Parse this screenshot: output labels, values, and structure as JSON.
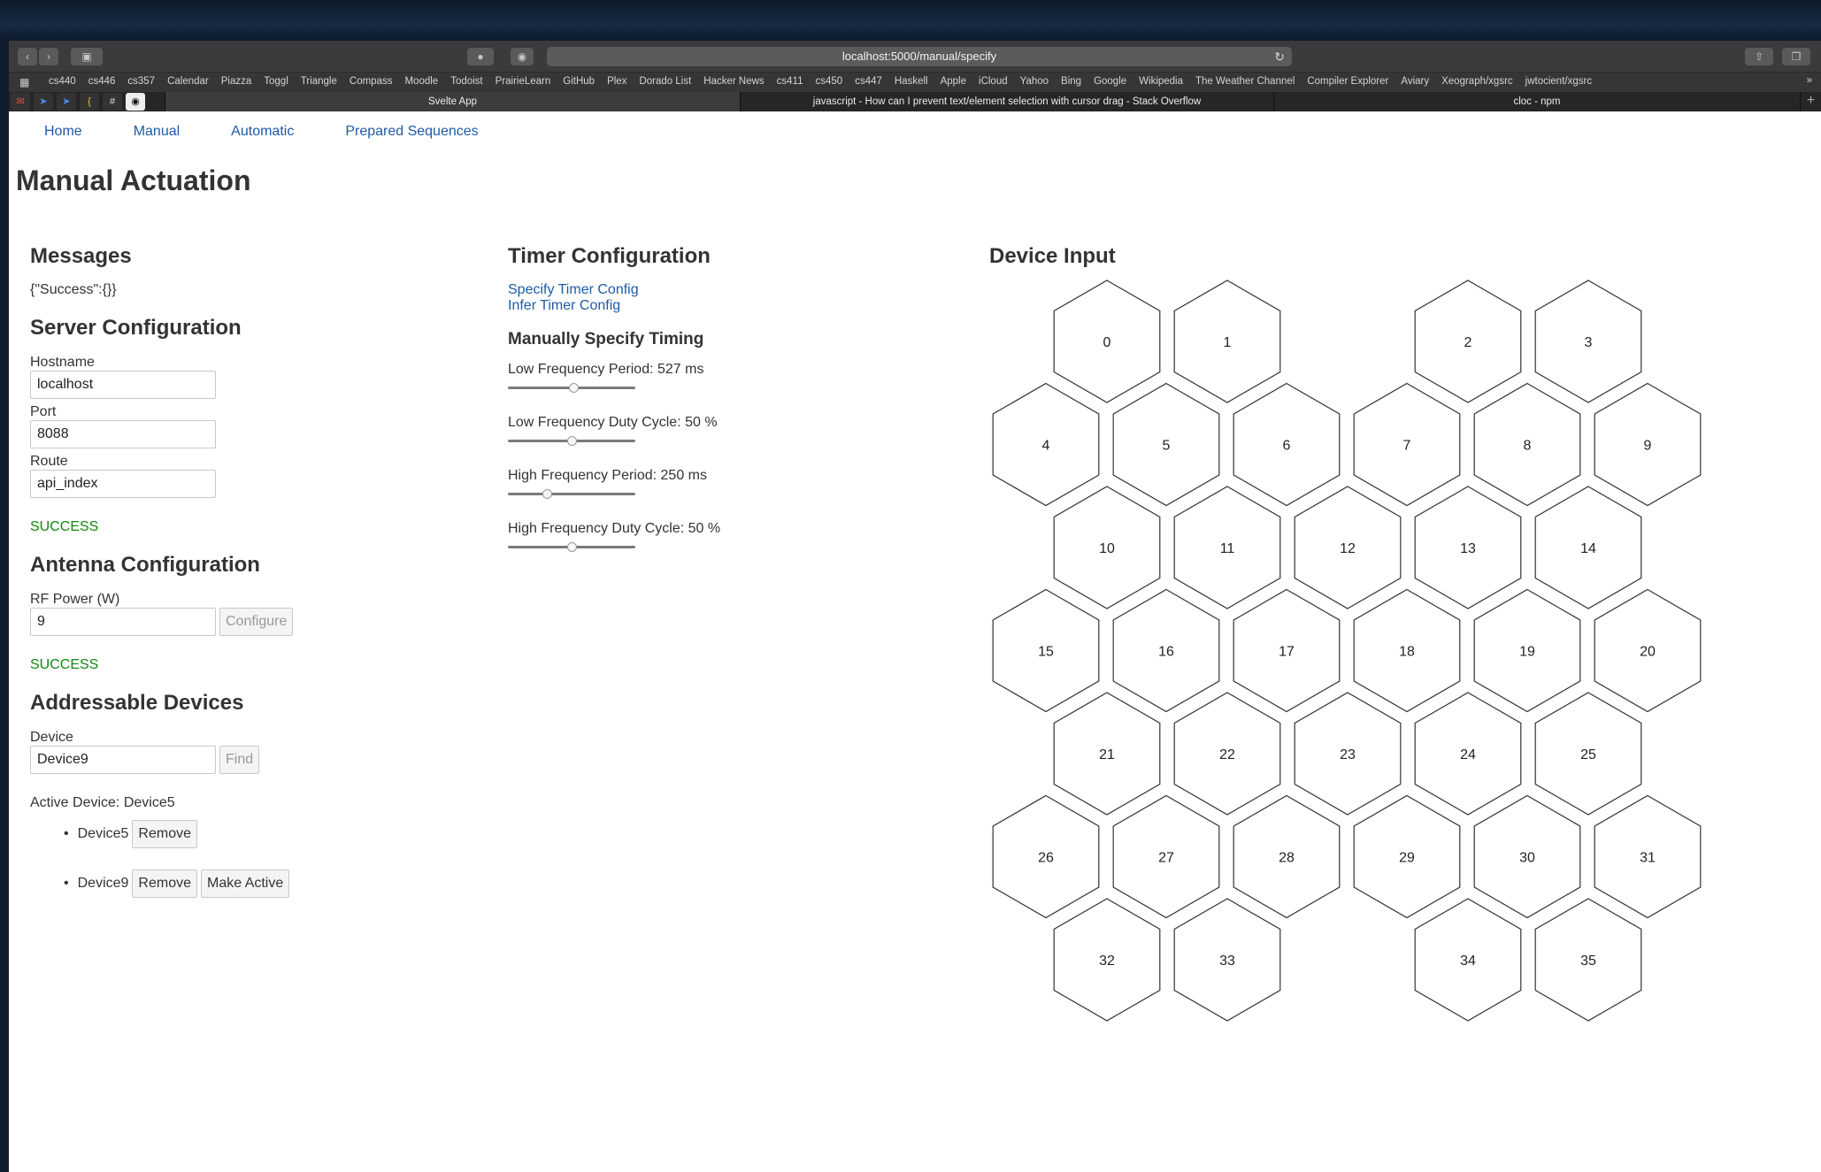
{
  "browser": {
    "url": "localhost:5000/manual/specify",
    "bookmarks": [
      "cs440",
      "cs446",
      "cs357",
      "Calendar",
      "Piazza",
      "Toggl",
      "Triangle",
      "Compass",
      "Moodle",
      "Todoist",
      "PrairieLearn",
      "GitHub",
      "Plex",
      "Dorado List",
      "Hacker News",
      "cs411",
      "cs450",
      "cs447",
      "Haskell",
      "Apple",
      "iCloud",
      "Yahoo",
      "Bing",
      "Google",
      "Wikipedia",
      "The Weather Channel",
      "Compiler Explorer",
      "Aviary",
      "Xeograph/xgsrc",
      "jwtocient/xgsrc"
    ],
    "tabs": [
      "Svelte App",
      "javascript - How can I prevent text/element selection with cursor drag - Stack Overflow",
      "cloc - npm"
    ]
  },
  "nav": {
    "items": [
      "Home",
      "Manual",
      "Automatic",
      "Prepared Sequences"
    ]
  },
  "page_title": "Manual Actuation",
  "messages": {
    "heading": "Messages",
    "text": "{\"Success\":{}}"
  },
  "server": {
    "heading": "Server Configuration",
    "hostname_label": "Hostname",
    "hostname": "localhost",
    "port_label": "Port",
    "port": "8088",
    "route_label": "Route",
    "route": "api_index",
    "status": "SUCCESS"
  },
  "antenna": {
    "heading": "Antenna Configuration",
    "rf_label": "RF Power (W)",
    "rf_value": "9",
    "configure_label": "Configure",
    "status": "SUCCESS"
  },
  "devices": {
    "heading": "Addressable Devices",
    "device_label": "Device",
    "device_value": "Device9",
    "find_label": "Find",
    "active_text": "Active Device: Device5",
    "list": [
      {
        "name": "Device5",
        "remove_label": "Remove"
      },
      {
        "name": "Device9",
        "remove_label": "Remove",
        "make_active_label": "Make Active"
      }
    ]
  },
  "timer": {
    "heading": "Timer Configuration",
    "specify_link": "Specify Timer Config",
    "infer_link": "Infer Timer Config",
    "subheading": "Manually Specify Timing",
    "sliders": [
      {
        "label": "Low Frequency Period: 527 ms",
        "level": 0.52
      },
      {
        "label": "Low Frequency Duty Cycle: 50 %",
        "level": 0.5
      },
      {
        "label": "High Frequency Period: 250 ms",
        "level": 0.29
      },
      {
        "label": "High Frequency Duty Cycle: 50 %",
        "level": 0.5
      }
    ]
  },
  "device_input": {
    "heading": "Device Input",
    "rows": [
      [
        "0",
        "1",
        "",
        "2",
        "3"
      ],
      [
        "4",
        "5",
        "6",
        "7",
        "8",
        "9"
      ],
      [
        "10",
        "11",
        "12",
        "13",
        "14"
      ],
      [
        "15",
        "16",
        "17",
        "18",
        "19",
        "20"
      ],
      [
        "21",
        "22",
        "23",
        "24",
        "25"
      ],
      [
        "26",
        "27",
        "28",
        "29",
        "30",
        "31"
      ],
      [
        "32",
        "33",
        "",
        "34",
        "35"
      ]
    ]
  }
}
